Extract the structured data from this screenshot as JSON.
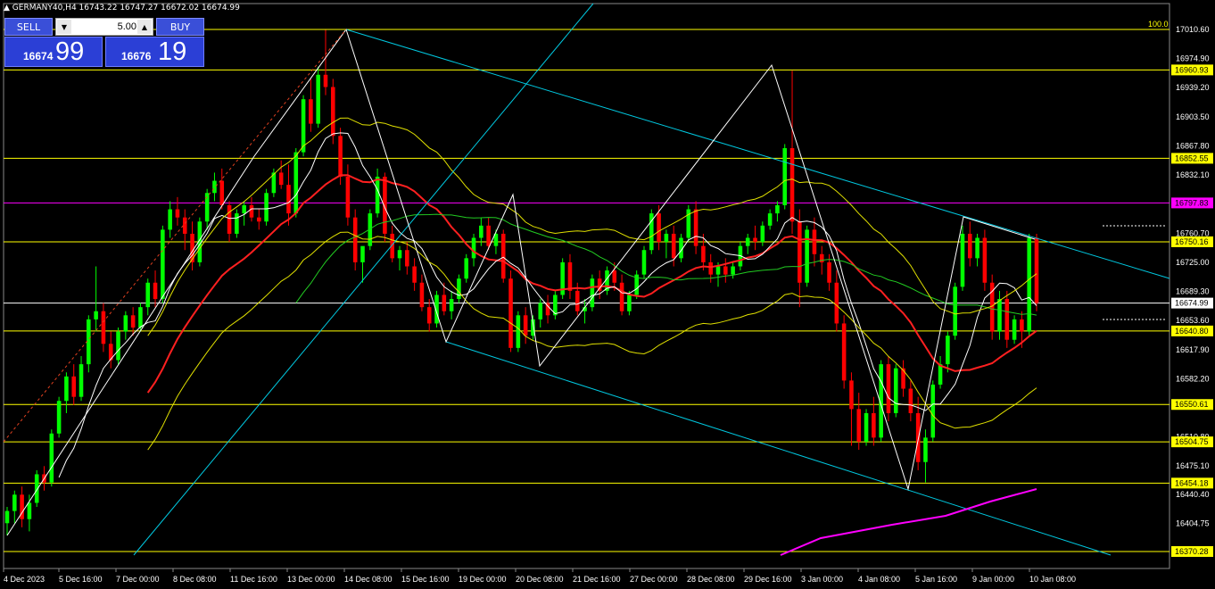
{
  "window": {
    "title": "GERMANY40,H4  16743.22 16747.27 16672.02 16674.99"
  },
  "trade": {
    "sell_label": "SELL",
    "buy_label": "BUY",
    "lot": "5.00",
    "sell_price_small": "16674",
    "sell_price_big": "99",
    "buy_price_small": "16676",
    "buy_price_big": "19"
  },
  "chart_data": {
    "type": "candlestick",
    "symbol": "GERMANY40",
    "timeframe": "H4",
    "ylim": [
      16370.28,
      17020
    ],
    "y_ticks": [
      "17010.60",
      "16974.90",
      "16939.20",
      "16903.50",
      "16867.80",
      "16832.10",
      "16760.70",
      "16725.00",
      "16689.30",
      "16653.60",
      "16617.90",
      "16582.20",
      "16510.80",
      "16475.10",
      "16440.40",
      "16404.75"
    ],
    "x_labels": [
      "4 Dec 2023",
      "5 Dec 16:00",
      "7 Dec 00:00",
      "8 Dec 08:00",
      "11 Dec 16:00",
      "13 Dec 00:00",
      "14 Dec 08:00",
      "15 Dec 16:00",
      "19 Dec 00:00",
      "20 Dec 08:00",
      "21 Dec 16:00",
      "27 Dec 00:00",
      "28 Dec 08:00",
      "29 Dec 16:00",
      "3 Jan 00:00",
      "4 Jan 08:00",
      "5 Jan 16:00",
      "9 Jan 00:00",
      "10 Jan 08:00"
    ],
    "levels": [
      {
        "label": "100.0",
        "value": 17010.6,
        "color": "#ffff00",
        "boxed": false
      },
      {
        "label": "16960.93",
        "value": 16960.93,
        "color": "#ffff00",
        "boxed": true
      },
      {
        "label": "16852.55",
        "value": 16852.55,
        "color": "#ffff00",
        "boxed": true
      },
      {
        "label": "16797.83",
        "value": 16797.83,
        "color": "#ff00ff",
        "boxed": true
      },
      {
        "label": "16750.16",
        "value": 16750.16,
        "color": "#ffff00",
        "boxed": true
      },
      {
        "label": "16674.99",
        "value": 16674.99,
        "color": "#ffffff",
        "boxed": true
      },
      {
        "label": "16640.80",
        "value": 16640.8,
        "color": "#ffff00",
        "boxed": true
      },
      {
        "label": "16550.61",
        "value": 16550.61,
        "color": "#ffff00",
        "boxed": true
      },
      {
        "label": "16504.75",
        "value": 16504.75,
        "color": "#ffff00",
        "boxed": true
      },
      {
        "label": "16454.18",
        "value": 16454.18,
        "color": "#ffff00",
        "boxed": true
      },
      {
        "label": "16370.28",
        "value": 16370.28,
        "color": "#ffff00",
        "boxed": true
      }
    ],
    "candles": [
      {
        "o": 16405,
        "h": 16425,
        "l": 16390,
        "c": 16420
      },
      {
        "o": 16420,
        "h": 16445,
        "l": 16405,
        "c": 16440
      },
      {
        "o": 16440,
        "h": 16450,
        "l": 16400,
        "c": 16410
      },
      {
        "o": 16410,
        "h": 16440,
        "l": 16395,
        "c": 16430
      },
      {
        "o": 16430,
        "h": 16470,
        "l": 16425,
        "c": 16465
      },
      {
        "o": 16465,
        "h": 16475,
        "l": 16445,
        "c": 16455
      },
      {
        "o": 16455,
        "h": 16520,
        "l": 16450,
        "c": 16515
      },
      {
        "o": 16515,
        "h": 16560,
        "l": 16510,
        "c": 16555
      },
      {
        "o": 16555,
        "h": 16590,
        "l": 16540,
        "c": 16585
      },
      {
        "o": 16585,
        "h": 16600,
        "l": 16550,
        "c": 16560
      },
      {
        "o": 16560,
        "h": 16610,
        "l": 16555,
        "c": 16600
      },
      {
        "o": 16600,
        "h": 16660,
        "l": 16590,
        "c": 16655
      },
      {
        "o": 16655,
        "h": 16720,
        "l": 16640,
        "c": 16665
      },
      {
        "o": 16665,
        "h": 16675,
        "l": 16615,
        "c": 16625
      },
      {
        "o": 16625,
        "h": 16640,
        "l": 16595,
        "c": 16605
      },
      {
        "o": 16605,
        "h": 16645,
        "l": 16600,
        "c": 16640
      },
      {
        "o": 16640,
        "h": 16665,
        "l": 16630,
        "c": 16660
      },
      {
        "o": 16660,
        "h": 16670,
        "l": 16635,
        "c": 16645
      },
      {
        "o": 16645,
        "h": 16675,
        "l": 16640,
        "c": 16670
      },
      {
        "o": 16670,
        "h": 16705,
        "l": 16660,
        "c": 16700
      },
      {
        "o": 16700,
        "h": 16715,
        "l": 16670,
        "c": 16680
      },
      {
        "o": 16680,
        "h": 16770,
        "l": 16675,
        "c": 16765
      },
      {
        "o": 16765,
        "h": 16800,
        "l": 16755,
        "c": 16790
      },
      {
        "o": 16790,
        "h": 16805,
        "l": 16770,
        "c": 16780
      },
      {
        "o": 16780,
        "h": 16790,
        "l": 16740,
        "c": 16760
      },
      {
        "o": 16760,
        "h": 16775,
        "l": 16715,
        "c": 16725
      },
      {
        "o": 16725,
        "h": 16780,
        "l": 16720,
        "c": 16775
      },
      {
        "o": 16775,
        "h": 16815,
        "l": 16765,
        "c": 16810
      },
      {
        "o": 16810,
        "h": 16835,
        "l": 16800,
        "c": 16825
      },
      {
        "o": 16825,
        "h": 16840,
        "l": 16790,
        "c": 16795
      },
      {
        "o": 16795,
        "h": 16800,
        "l": 16750,
        "c": 16760
      },
      {
        "o": 16760,
        "h": 16790,
        "l": 16755,
        "c": 16785
      },
      {
        "o": 16785,
        "h": 16800,
        "l": 16770,
        "c": 16795
      },
      {
        "o": 16795,
        "h": 16805,
        "l": 16775,
        "c": 16780
      },
      {
        "o": 16780,
        "h": 16790,
        "l": 16765,
        "c": 16775
      },
      {
        "o": 16775,
        "h": 16815,
        "l": 16770,
        "c": 16810
      },
      {
        "o": 16810,
        "h": 16840,
        "l": 16805,
        "c": 16835
      },
      {
        "o": 16835,
        "h": 16850,
        "l": 16815,
        "c": 16820
      },
      {
        "o": 16820,
        "h": 16845,
        "l": 16770,
        "c": 16785
      },
      {
        "o": 16785,
        "h": 16865,
        "l": 16780,
        "c": 16860
      },
      {
        "o": 16860,
        "h": 16930,
        "l": 16855,
        "c": 16925
      },
      {
        "o": 16925,
        "h": 16950,
        "l": 16885,
        "c": 16895
      },
      {
        "o": 16895,
        "h": 16965,
        "l": 16890,
        "c": 16955
      },
      {
        "o": 16955,
        "h": 17010,
        "l": 16930,
        "c": 16940
      },
      {
        "o": 16940,
        "h": 16950,
        "l": 16870,
        "c": 16880
      },
      {
        "o": 16880,
        "h": 16890,
        "l": 16820,
        "c": 16830
      },
      {
        "o": 16830,
        "h": 16845,
        "l": 16770,
        "c": 16780
      },
      {
        "o": 16780,
        "h": 16790,
        "l": 16715,
        "c": 16725
      },
      {
        "o": 16725,
        "h": 16740,
        "l": 16700,
        "c": 16745
      },
      {
        "o": 16745,
        "h": 16790,
        "l": 16740,
        "c": 16785
      },
      {
        "o": 16785,
        "h": 16840,
        "l": 16780,
        "c": 16830
      },
      {
        "o": 16830,
        "h": 16835,
        "l": 16750,
        "c": 16760
      },
      {
        "o": 16760,
        "h": 16770,
        "l": 16725,
        "c": 16730
      },
      {
        "o": 16730,
        "h": 16745,
        "l": 16715,
        "c": 16740
      },
      {
        "o": 16740,
        "h": 16750,
        "l": 16710,
        "c": 16720
      },
      {
        "o": 16720,
        "h": 16730,
        "l": 16690,
        "c": 16700
      },
      {
        "o": 16700,
        "h": 16710,
        "l": 16665,
        "c": 16670
      },
      {
        "o": 16670,
        "h": 16680,
        "l": 16640,
        "c": 16650
      },
      {
        "o": 16650,
        "h": 16690,
        "l": 16645,
        "c": 16685
      },
      {
        "o": 16685,
        "h": 16700,
        "l": 16660,
        "c": 16665
      },
      {
        "o": 16665,
        "h": 16690,
        "l": 16655,
        "c": 16680
      },
      {
        "o": 16680,
        "h": 16710,
        "l": 16675,
        "c": 16705
      },
      {
        "o": 16705,
        "h": 16735,
        "l": 16700,
        "c": 16730
      },
      {
        "o": 16730,
        "h": 16760,
        "l": 16720,
        "c": 16755
      },
      {
        "o": 16755,
        "h": 16780,
        "l": 16745,
        "c": 16770
      },
      {
        "o": 16770,
        "h": 16780,
        "l": 16740,
        "c": 16745
      },
      {
        "o": 16745,
        "h": 16765,
        "l": 16735,
        "c": 16760
      },
      {
        "o": 16760,
        "h": 16765,
        "l": 16700,
        "c": 16705
      },
      {
        "o": 16705,
        "h": 16715,
        "l": 16615,
        "c": 16620
      },
      {
        "o": 16620,
        "h": 16665,
        "l": 16615,
        "c": 16660
      },
      {
        "o": 16660,
        "h": 16670,
        "l": 16625,
        "c": 16635
      },
      {
        "o": 16635,
        "h": 16660,
        "l": 16630,
        "c": 16655
      },
      {
        "o": 16655,
        "h": 16680,
        "l": 16645,
        "c": 16675
      },
      {
        "o": 16675,
        "h": 16685,
        "l": 16650,
        "c": 16660
      },
      {
        "o": 16660,
        "h": 16690,
        "l": 16655,
        "c": 16685
      },
      {
        "o": 16685,
        "h": 16730,
        "l": 16680,
        "c": 16725
      },
      {
        "o": 16725,
        "h": 16735,
        "l": 16680,
        "c": 16690
      },
      {
        "o": 16690,
        "h": 16700,
        "l": 16660,
        "c": 16665
      },
      {
        "o": 16665,
        "h": 16680,
        "l": 16650,
        "c": 16670
      },
      {
        "o": 16670,
        "h": 16710,
        "l": 16665,
        "c": 16705
      },
      {
        "o": 16705,
        "h": 16715,
        "l": 16680,
        "c": 16690
      },
      {
        "o": 16690,
        "h": 16720,
        "l": 16685,
        "c": 16715
      },
      {
        "o": 16715,
        "h": 16725,
        "l": 16690,
        "c": 16700
      },
      {
        "o": 16700,
        "h": 16710,
        "l": 16660,
        "c": 16665
      },
      {
        "o": 16665,
        "h": 16690,
        "l": 16660,
        "c": 16685
      },
      {
        "o": 16685,
        "h": 16715,
        "l": 16680,
        "c": 16710
      },
      {
        "o": 16710,
        "h": 16745,
        "l": 16705,
        "c": 16740
      },
      {
        "o": 16740,
        "h": 16790,
        "l": 16735,
        "c": 16785
      },
      {
        "o": 16785,
        "h": 16795,
        "l": 16740,
        "c": 16750
      },
      {
        "o": 16750,
        "h": 16765,
        "l": 16730,
        "c": 16760
      },
      {
        "o": 16760,
        "h": 16770,
        "l": 16720,
        "c": 16730
      },
      {
        "o": 16730,
        "h": 16760,
        "l": 16725,
        "c": 16755
      },
      {
        "o": 16755,
        "h": 16795,
        "l": 16750,
        "c": 16790
      },
      {
        "o": 16790,
        "h": 16800,
        "l": 16735,
        "c": 16745
      },
      {
        "o": 16745,
        "h": 16760,
        "l": 16715,
        "c": 16725
      },
      {
        "o": 16725,
        "h": 16735,
        "l": 16700,
        "c": 16710
      },
      {
        "o": 16710,
        "h": 16725,
        "l": 16695,
        "c": 16720
      },
      {
        "o": 16720,
        "h": 16730,
        "l": 16700,
        "c": 16710
      },
      {
        "o": 16710,
        "h": 16725,
        "l": 16705,
        "c": 16720
      },
      {
        "o": 16720,
        "h": 16750,
        "l": 16715,
        "c": 16745
      },
      {
        "o": 16745,
        "h": 16760,
        "l": 16735,
        "c": 16755
      },
      {
        "o": 16755,
        "h": 16770,
        "l": 16740,
        "c": 16750
      },
      {
        "o": 16750,
        "h": 16775,
        "l": 16745,
        "c": 16770
      },
      {
        "o": 16770,
        "h": 16790,
        "l": 16765,
        "c": 16785
      },
      {
        "o": 16785,
        "h": 16800,
        "l": 16775,
        "c": 16795
      },
      {
        "o": 16795,
        "h": 16870,
        "l": 16790,
        "c": 16865
      },
      {
        "o": 16865,
        "h": 16960,
        "l": 16760,
        "c": 16775
      },
      {
        "o": 16775,
        "h": 16790,
        "l": 16670,
        "c": 16700
      },
      {
        "o": 16700,
        "h": 16770,
        "l": 16695,
        "c": 16765
      },
      {
        "o": 16765,
        "h": 16780,
        "l": 16720,
        "c": 16735
      },
      {
        "o": 16735,
        "h": 16745,
        "l": 16710,
        "c": 16725
      },
      {
        "o": 16725,
        "h": 16735,
        "l": 16690,
        "c": 16700
      },
      {
        "o": 16700,
        "h": 16715,
        "l": 16640,
        "c": 16650
      },
      {
        "o": 16650,
        "h": 16660,
        "l": 16570,
        "c": 16580
      },
      {
        "o": 16580,
        "h": 16590,
        "l": 16500,
        "c": 16545
      },
      {
        "o": 16545,
        "h": 16565,
        "l": 16495,
        "c": 16505
      },
      {
        "o": 16505,
        "h": 16545,
        "l": 16500,
        "c": 16540
      },
      {
        "o": 16540,
        "h": 16560,
        "l": 16500,
        "c": 16510
      },
      {
        "o": 16510,
        "h": 16605,
        "l": 16505,
        "c": 16600
      },
      {
        "o": 16600,
        "h": 16610,
        "l": 16530,
        "c": 16540
      },
      {
        "o": 16540,
        "h": 16600,
        "l": 16535,
        "c": 16595
      },
      {
        "o": 16595,
        "h": 16605,
        "l": 16560,
        "c": 16570
      },
      {
        "o": 16570,
        "h": 16580,
        "l": 16530,
        "c": 16540
      },
      {
        "o": 16540,
        "h": 16560,
        "l": 16470,
        "c": 16480
      },
      {
        "o": 16480,
        "h": 16520,
        "l": 16455,
        "c": 16510
      },
      {
        "o": 16510,
        "h": 16580,
        "l": 16505,
        "c": 16575
      },
      {
        "o": 16575,
        "h": 16610,
        "l": 16570,
        "c": 16600
      },
      {
        "o": 16600,
        "h": 16640,
        "l": 16590,
        "c": 16635
      },
      {
        "o": 16635,
        "h": 16700,
        "l": 16630,
        "c": 16695
      },
      {
        "o": 16695,
        "h": 16770,
        "l": 16690,
        "c": 16760
      },
      {
        "o": 16760,
        "h": 16775,
        "l": 16720,
        "c": 16730
      },
      {
        "o": 16730,
        "h": 16760,
        "l": 16720,
        "c": 16755
      },
      {
        "o": 16755,
        "h": 16765,
        "l": 16690,
        "c": 16700
      },
      {
        "o": 16700,
        "h": 16710,
        "l": 16630,
        "c": 16640
      },
      {
        "o": 16640,
        "h": 16690,
        "l": 16630,
        "c": 16680
      },
      {
        "o": 16680,
        "h": 16690,
        "l": 16620,
        "c": 16630
      },
      {
        "o": 16630,
        "h": 16660,
        "l": 16625,
        "c": 16655
      },
      {
        "o": 16655,
        "h": 16665,
        "l": 16620,
        "c": 16640
      },
      {
        "o": 16640,
        "h": 16760,
        "l": 16635,
        "c": 16755
      },
      {
        "o": 16755,
        "h": 16760,
        "l": 16665,
        "c": 16675
      }
    ]
  }
}
